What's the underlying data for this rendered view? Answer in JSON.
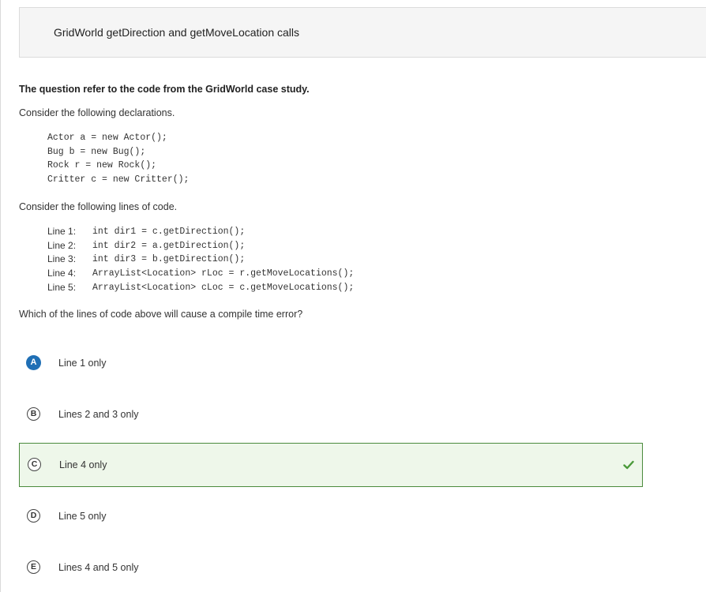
{
  "title": "GridWorld getDirection and getMoveLocation calls",
  "intro": "The question refer to the code from the GridWorld case study.",
  "consider_declarations": "Consider the following declarations.",
  "declarations": [
    "Actor a = new Actor();",
    "Bug b = new Bug();",
    "Rock r = new Rock();",
    "Critter c = new Critter();"
  ],
  "consider_lines": "Consider the following lines of code.",
  "code_lines": [
    {
      "label": "Line 1:",
      "code": "int dir1 = c.getDirection();"
    },
    {
      "label": "Line 2:",
      "code": "int dir2 = a.getDirection();"
    },
    {
      "label": "Line 3:",
      "code": "int dir3 = b.getDirection();"
    },
    {
      "label": "Line 4:",
      "code": "ArrayList<Location> rLoc = r.getMoveLocations();"
    },
    {
      "label": "Line 5:",
      "code": "ArrayList<Location> cLoc = c.getMoveLocations();"
    }
  ],
  "question": "Which of the lines of code above will cause a compile time error?",
  "options": [
    {
      "letter": "A",
      "text": "Line 1 only"
    },
    {
      "letter": "B",
      "text": "Lines 2 and 3 only"
    },
    {
      "letter": "C",
      "text": "Line 4 only"
    },
    {
      "letter": "D",
      "text": "Line 5 only"
    },
    {
      "letter": "E",
      "text": "Lines 4 and 5 only"
    }
  ],
  "selected_option": "A",
  "correct_option": "C",
  "colors": {
    "selected_badge": "#1f6fb5",
    "correct_border": "#4a8a3c",
    "correct_background": "#eef7ea",
    "check": "#4a9a3a"
  },
  "icons": {
    "correct_mark": "check-icon"
  }
}
